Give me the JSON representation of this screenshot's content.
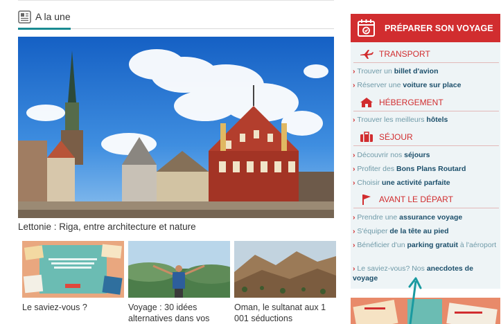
{
  "section": {
    "title": "A la une",
    "icon": "newspaper-icon"
  },
  "hero": {
    "caption": "Lettonie : Riga, entre architecture et nature"
  },
  "thumbnails": [
    {
      "caption": "Le saviez-vous ?"
    },
    {
      "caption": "Voyage : 30 idées alternatives dans vos"
    },
    {
      "caption": "Oman, le sultanat aux 1 001 séductions"
    }
  ],
  "sidebar": {
    "title": "PRÉPARER SON VOYAGE",
    "categories": [
      {
        "label": "TRANSPORT",
        "icon": "plane-icon",
        "links": [
          {
            "pre": "Trouver un ",
            "bold": "billet d'avion",
            "post": ""
          },
          {
            "pre": "Réserver une ",
            "bold": "voiture sur place",
            "post": ""
          }
        ]
      },
      {
        "label": "HÉBERGEMENT",
        "icon": "house-icon",
        "links": [
          {
            "pre": "Trouver les meilleurs ",
            "bold": "hôtels",
            "post": ""
          }
        ]
      },
      {
        "label": "SÉJOUR",
        "icon": "suitcase-icon",
        "links": [
          {
            "pre": "Découvrir nos ",
            "bold": "séjours",
            "post": ""
          },
          {
            "pre": "Profiter des ",
            "bold": "Bons Plans Routard",
            "post": ""
          },
          {
            "pre": "Choisir ",
            "bold": "une activité parfaite",
            "post": ""
          }
        ]
      },
      {
        "label": "AVANT LE DÉPART",
        "icon": "flag-icon",
        "links": [
          {
            "pre": "Prendre une ",
            "bold": "assurance voyage",
            "post": ""
          },
          {
            "pre": "S'équiper ",
            "bold": "de la tête au pied",
            "post": ""
          },
          {
            "pre": "Bénéficier d'un ",
            "bold": "parking gratuit",
            "post": " à l'aéroport"
          },
          {
            "pre": "Le saviez-vous? Nos ",
            "bold": "anecdotes de voyage",
            "post": ""
          }
        ]
      }
    ]
  },
  "colors": {
    "accent_red": "#d12d2f",
    "accent_teal": "#1a8a91",
    "link_bold": "#1c4f6b",
    "link_light": "#6f9aa8"
  }
}
